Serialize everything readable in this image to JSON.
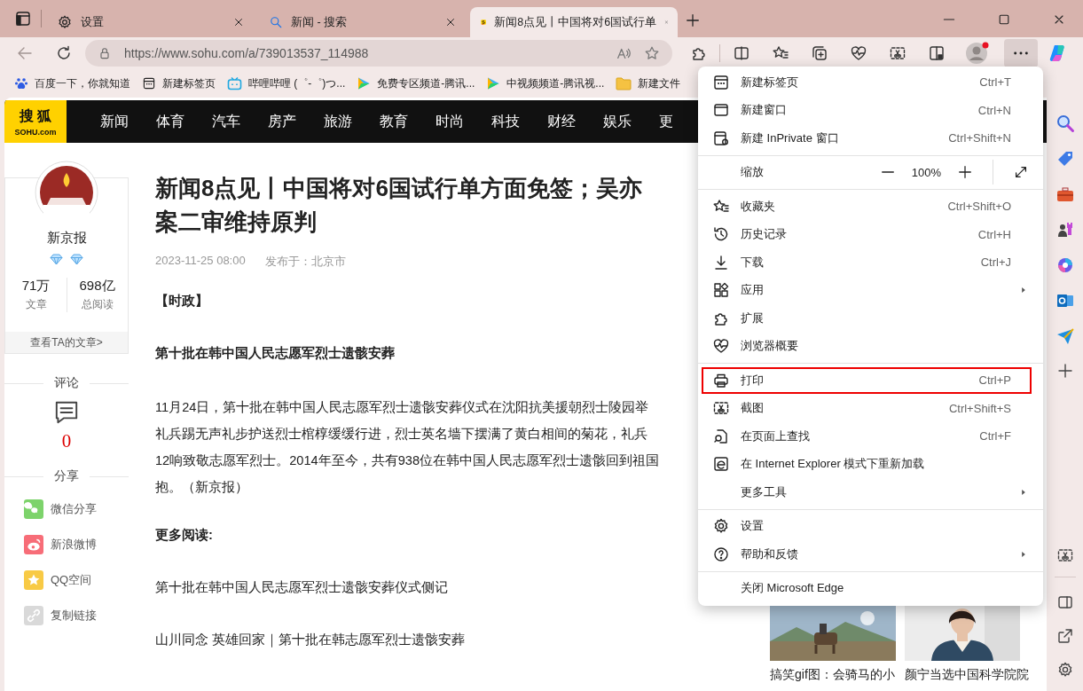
{
  "tabs": [
    {
      "label": "设置",
      "selected": false
    },
    {
      "label": "新闻 - 搜索",
      "selected": false
    },
    {
      "label": "新闻8点见丨中国将对6国试行单",
      "selected": true
    }
  ],
  "address": {
    "url": "https://www.sohu.com/a/739013537_114988"
  },
  "more_button": {
    "expanded": true
  },
  "bookmarks": [
    "百度一下，你就知道",
    "新建标签页",
    "哔哩哔哩 (゜-゜)つ...",
    "免费专区频道-腾讯...",
    "中视频频道-腾讯视...",
    "新建文件"
  ],
  "site": {
    "logo_name": "搜 狐",
    "logo_domain": "SOHU.com",
    "nav": [
      "新闻",
      "体育",
      "汽车",
      "房产",
      "旅游",
      "教育",
      "时尚",
      "科技",
      "财经",
      "娱乐",
      "更"
    ]
  },
  "author": {
    "name": "新京报",
    "stats": [
      {
        "value": "71万",
        "label": "文章"
      },
      {
        "value": "698亿",
        "label": "总阅读"
      }
    ],
    "link": "查看TA的文章>"
  },
  "comments": {
    "title": "评论",
    "count": "0"
  },
  "share": {
    "title": "分享",
    "items": [
      {
        "label": "微信分享",
        "color": "#7dd36b"
      },
      {
        "label": "新浪微博",
        "color": "#f76d78"
      },
      {
        "label": "QQ空间",
        "color": "#f8ca45"
      },
      {
        "label": "复制链接",
        "color": "#d9d9d9"
      }
    ]
  },
  "article": {
    "title_lines": [
      "新闻8点见丨中国将对6国试行单方面免签；吴亦",
      "案二审维持原判"
    ],
    "date": "2023-11-25 08:00",
    "location": "发布于：北京市",
    "section": "【时政】",
    "heading": "第十批在韩中国人民志愿军烈士遗骸安葬",
    "paragraph_lines": [
      "11月24日，第十批在韩中国人民志愿军烈士遗骸安葬仪式在沈阳抗美援朝烈士陵园举",
      "礼兵踢无声礼步护送烈士棺椁缓缓行进，烈士英名墙下摆满了黄白相间的菊花，礼兵",
      "12响致敬志愿军烈士。2014年至今，共有938位在韩中国人民志愿军烈士遗骸回到祖国",
      "抱。（新京报）"
    ],
    "more_heading": "更多阅读:",
    "related": [
      "第十批在韩中国人民志愿军烈士遗骸安葬仪式侧记",
      "山川同念 英雄回家｜第十批在韩志愿军烈士遗骸安葬"
    ]
  },
  "cards": [
    {
      "kind": "picture",
      "caption": "搞笑gif图：会骑马的小"
    },
    {
      "kind": "picture",
      "caption": "颜宁当选中国科学院院"
    }
  ],
  "menu": {
    "items": [
      {
        "kind": "item",
        "label": "新建标签页",
        "shortcut": "Ctrl+T",
        "submenu": false,
        "highlighted": false
      },
      {
        "kind": "item",
        "label": "新建窗口",
        "shortcut": "Ctrl+N",
        "submenu": false,
        "highlighted": false
      },
      {
        "kind": "item",
        "label": "新建 InPrivate 窗口",
        "shortcut": "Ctrl+Shift+N",
        "submenu": false,
        "highlighted": false
      },
      {
        "kind": "divider"
      },
      {
        "kind": "zoom",
        "label": "缩放",
        "value": "100%"
      },
      {
        "kind": "divider"
      },
      {
        "kind": "item",
        "label": "收藏夹",
        "shortcut": "Ctrl+Shift+O",
        "submenu": false,
        "highlighted": false
      },
      {
        "kind": "item",
        "label": "历史记录",
        "shortcut": "Ctrl+H",
        "submenu": false,
        "highlighted": false
      },
      {
        "kind": "item",
        "label": "下载",
        "shortcut": "Ctrl+J",
        "submenu": false,
        "highlighted": false
      },
      {
        "kind": "item",
        "label": "应用",
        "submenu": true,
        "highlighted": false
      },
      {
        "kind": "item",
        "label": "扩展",
        "submenu": false,
        "highlighted": false
      },
      {
        "kind": "item",
        "label": "浏览器概要",
        "submenu": false,
        "highlighted": false
      },
      {
        "kind": "divider"
      },
      {
        "kind": "item",
        "label": "打印",
        "shortcut": "Ctrl+P",
        "submenu": false,
        "highlighted": true
      },
      {
        "kind": "item",
        "label": "截图",
        "shortcut": "Ctrl+Shift+S",
        "submenu": false,
        "highlighted": false
      },
      {
        "kind": "item",
        "label": "在页面上查找",
        "shortcut": "Ctrl+F",
        "submenu": false,
        "highlighted": false
      },
      {
        "kind": "item",
        "label": "在 Internet Explorer 模式下重新加载",
        "submenu": false,
        "highlighted": false
      },
      {
        "kind": "item",
        "label": "更多工具",
        "submenu": true,
        "highlighted": false
      },
      {
        "kind": "divider"
      },
      {
        "kind": "item",
        "label": "设置",
        "submenu": false,
        "highlighted": false
      },
      {
        "kind": "item",
        "label": "帮助和反馈",
        "submenu": true,
        "highlighted": false
      },
      {
        "kind": "divider"
      },
      {
        "kind": "item",
        "label": "关闭 Microsoft Edge",
        "submenu": false,
        "highlighted": false
      }
    ]
  }
}
